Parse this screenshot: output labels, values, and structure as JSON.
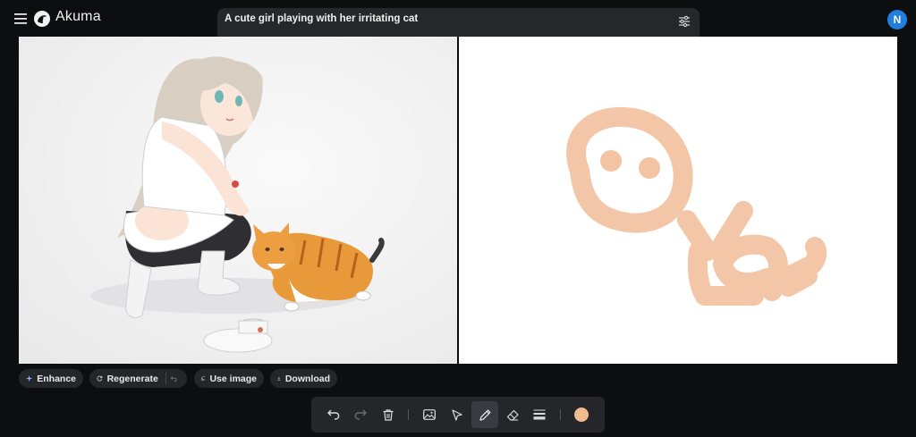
{
  "app": {
    "name": "Akuma",
    "avatar_initial": "N"
  },
  "prompt": {
    "text": "A cute girl playing with her irritating cat"
  },
  "actions": {
    "enhance": "Enhance",
    "regenerate": "Regenerate",
    "use_image": "Use image",
    "download": "Download"
  },
  "icons": {
    "menu": "hamburger-icon",
    "logo": "akuma-logo",
    "prompt_settings": "sliders-icon",
    "enhance": "sparkle-icon",
    "regenerate": "refresh-icon",
    "undo_generation": "undo-icon",
    "use_image": "image-copy-icon",
    "download": "download-icon",
    "tools": [
      "undo-icon",
      "redo-icon",
      "trash-icon",
      "image-icon",
      "pointer-icon",
      "pencil-icon",
      "eraser-icon",
      "stroke-width-icon"
    ]
  },
  "canvas": {
    "brush_color": "#f0bb8e",
    "active_tool": "pencil"
  },
  "colors": {
    "background": "#0d0e10",
    "panel": "#25262a",
    "avatar": "#1f7fe0",
    "sketch_stroke": "#f2c4a2"
  }
}
